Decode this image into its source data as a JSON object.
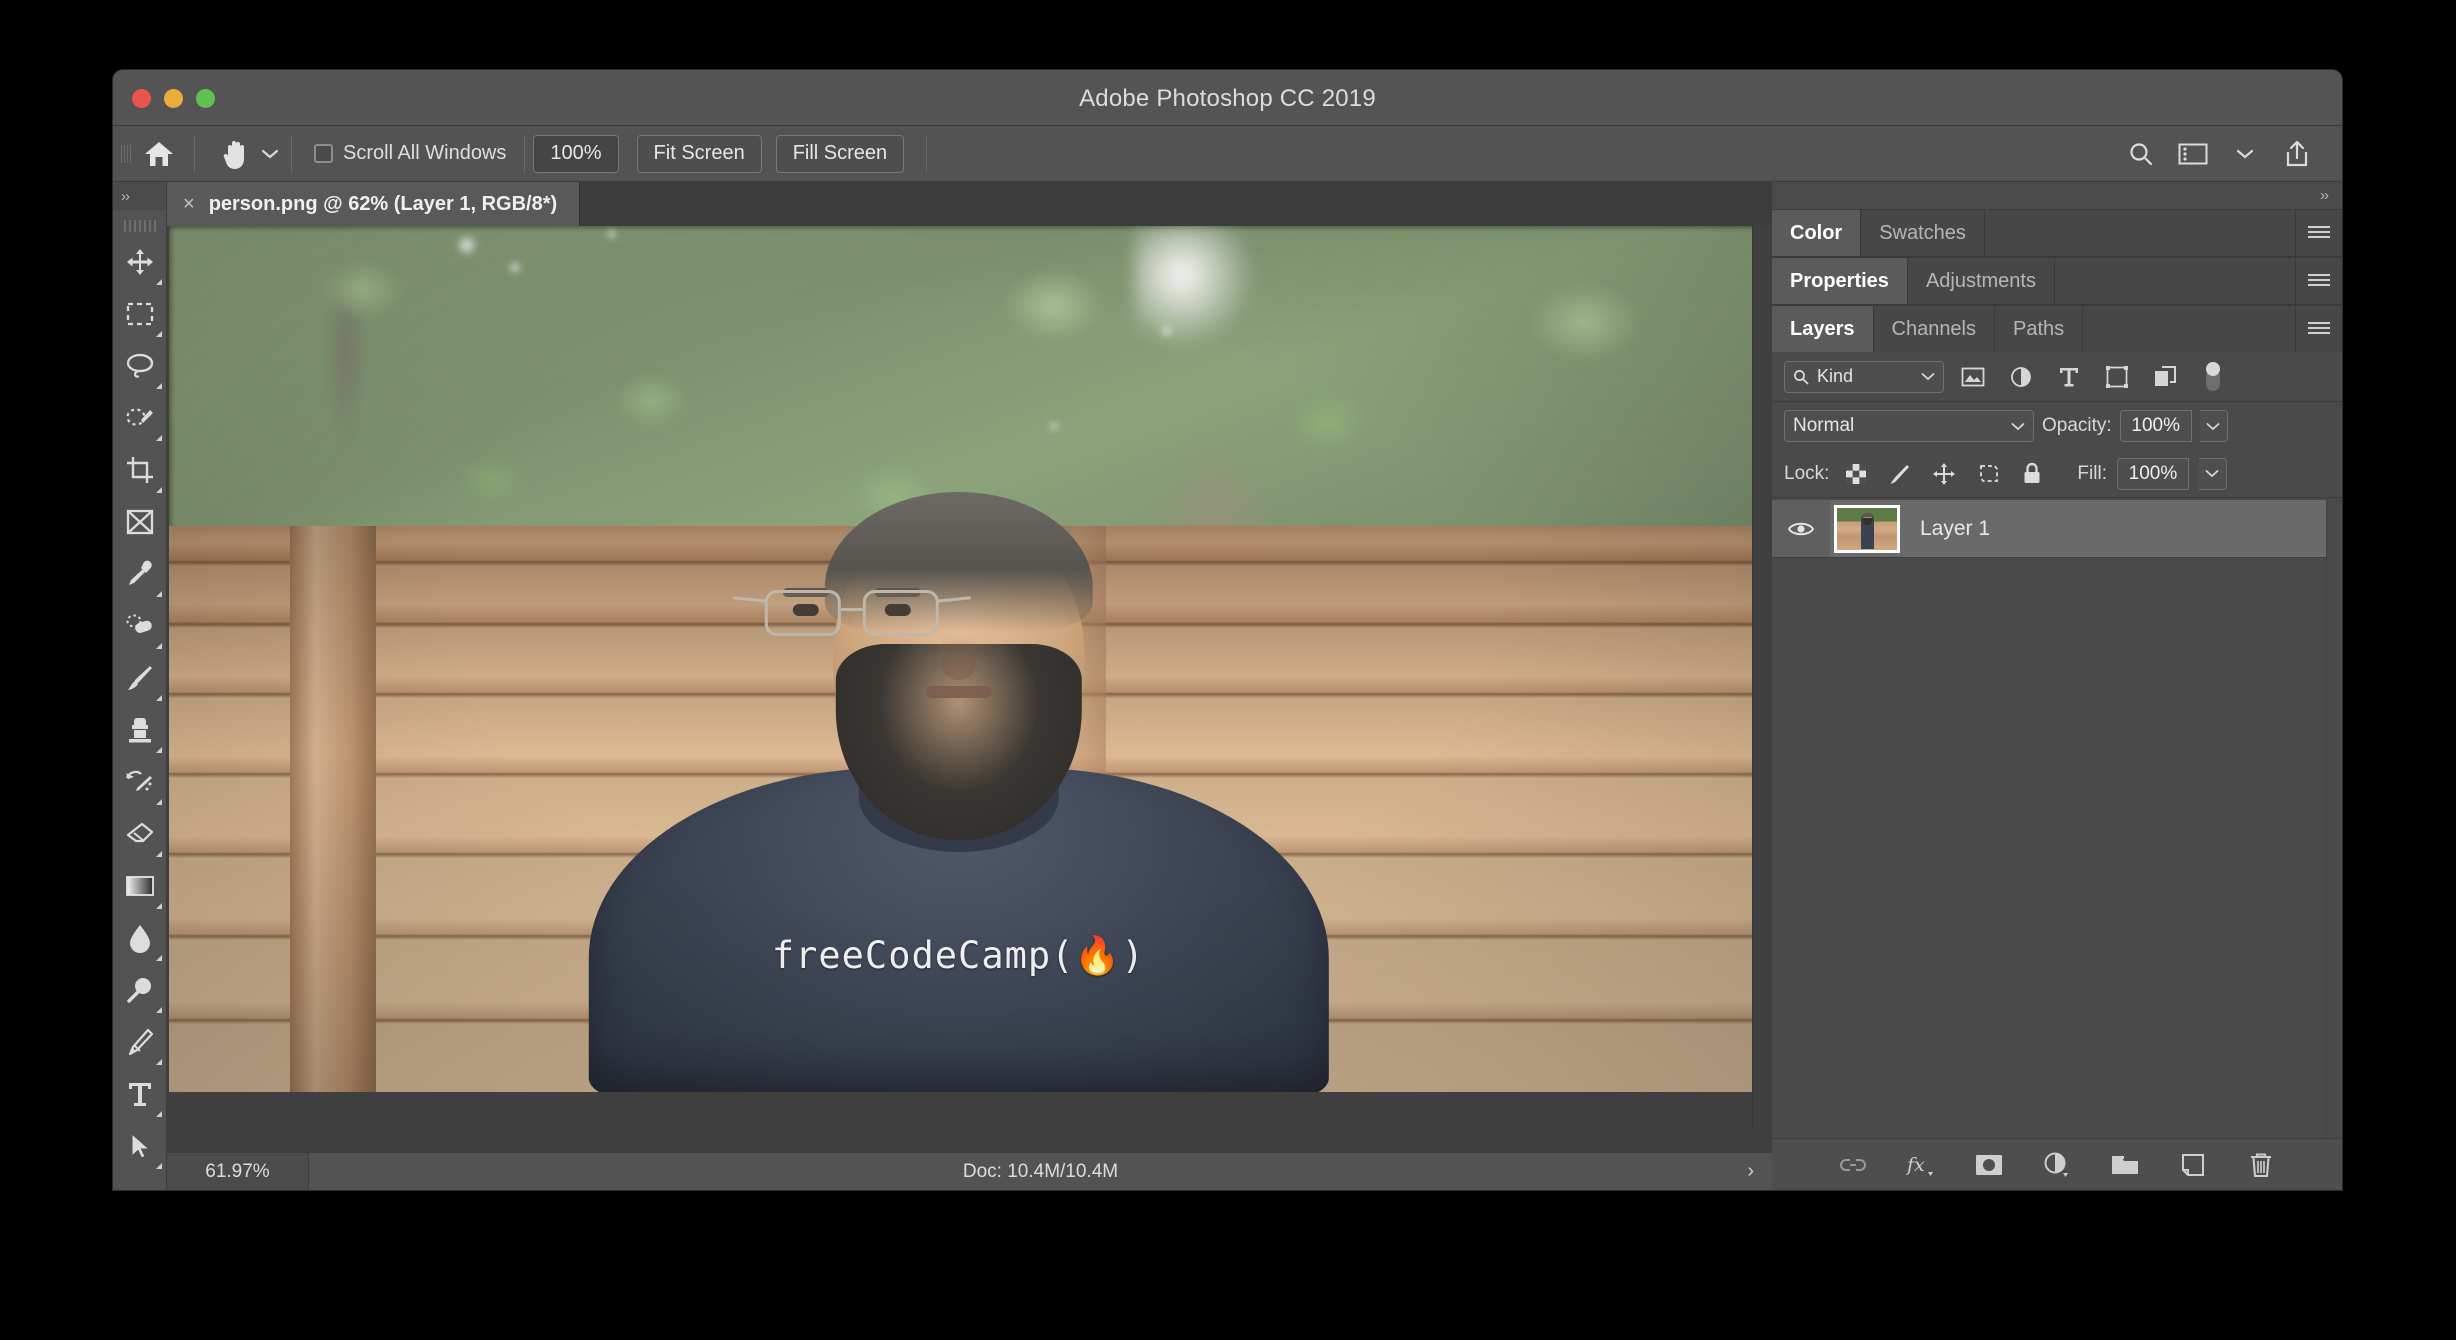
{
  "window": {
    "title": "Adobe Photoshop CC 2019",
    "traffic_lights": [
      "close",
      "minimize",
      "zoom"
    ]
  },
  "options_bar": {
    "home_icon": "home-icon",
    "tool_icon": "hand-tool-icon",
    "tool_caret": "chevron-down-icon",
    "scroll_all_windows": {
      "label": "Scroll All Windows",
      "checked": false
    },
    "zoom_percent": "100%",
    "fit_screen": "Fit Screen",
    "fill_screen": "Fill Screen",
    "right_icons": [
      "search-icon",
      "workspace-icon",
      "chevron-down-icon",
      "share-icon"
    ]
  },
  "toolbar": {
    "collapse_label": "››",
    "tools": [
      {
        "name": "move-tool",
        "glyph": "move",
        "selected": false,
        "has_flyout": true
      },
      {
        "name": "rectangular-marquee-tool",
        "glyph": "marquee",
        "selected": false,
        "has_flyout": true
      },
      {
        "name": "lasso-tool",
        "glyph": "lasso",
        "selected": false,
        "has_flyout": true
      },
      {
        "name": "quick-selection-tool",
        "glyph": "quickselect",
        "selected": false,
        "has_flyout": true
      },
      {
        "name": "crop-tool",
        "glyph": "crop",
        "selected": false,
        "has_flyout": true
      },
      {
        "name": "frame-tool",
        "glyph": "frame",
        "selected": false,
        "has_flyout": false
      },
      {
        "name": "eyedropper-tool",
        "glyph": "eyedropper",
        "selected": false,
        "has_flyout": true
      },
      {
        "name": "healing-brush-tool",
        "glyph": "healing",
        "selected": false,
        "has_flyout": true
      },
      {
        "name": "brush-tool",
        "glyph": "brush",
        "selected": false,
        "has_flyout": true
      },
      {
        "name": "clone-stamp-tool",
        "glyph": "stamp",
        "selected": false,
        "has_flyout": true
      },
      {
        "name": "history-brush-tool",
        "glyph": "historybrush",
        "selected": false,
        "has_flyout": true
      },
      {
        "name": "eraser-tool",
        "glyph": "eraser",
        "selected": false,
        "has_flyout": true
      },
      {
        "name": "gradient-tool",
        "glyph": "gradient",
        "selected": false,
        "has_flyout": true
      },
      {
        "name": "blur-tool",
        "glyph": "blur",
        "selected": false,
        "has_flyout": true
      },
      {
        "name": "dodge-tool",
        "glyph": "dodge",
        "selected": false,
        "has_flyout": true
      },
      {
        "name": "pen-tool",
        "glyph": "pen",
        "selected": false,
        "has_flyout": true
      },
      {
        "name": "type-tool",
        "glyph": "type",
        "selected": false,
        "has_flyout": true
      },
      {
        "name": "path-selection-tool",
        "glyph": "pathselect",
        "selected": false,
        "has_flyout": true
      }
    ]
  },
  "document": {
    "tab_close": "×",
    "tab_label": "person.png @ 62% (Layer 1, RGB/8*)",
    "image_alt": "bearded-man-in-freecodecamp-tshirt-in-front-of-wooden-fence",
    "shirt_text": "freeCodeCamp(🔥)"
  },
  "status_bar": {
    "zoom": "61.97%",
    "doc": "Doc: 10.4M/10.4M",
    "expand_arrow": "›"
  },
  "right_rail": {
    "collapse_label": "››",
    "color_group": {
      "tabs": [
        {
          "label": "Color",
          "active": true
        },
        {
          "label": "Swatches",
          "active": false
        }
      ],
      "menu_icon": "panel-menu-icon"
    },
    "properties_group": {
      "tabs": [
        {
          "label": "Properties",
          "active": true
        },
        {
          "label": "Adjustments",
          "active": false
        }
      ],
      "menu_icon": "panel-menu-icon"
    },
    "layers_group": {
      "tabs": [
        {
          "label": "Layers",
          "active": true
        },
        {
          "label": "Channels",
          "active": false
        },
        {
          "label": "Paths",
          "active": false
        }
      ],
      "menu_icon": "panel-menu-icon"
    }
  },
  "layers_panel": {
    "filter": {
      "search_icon": "search-icon",
      "kind_label": "Kind",
      "caret": "chevron-down-icon",
      "filter_icons": [
        "pixel-layer-filter-icon",
        "adjustment-layer-filter-icon",
        "type-layer-filter-icon",
        "shape-layer-filter-icon",
        "smart-object-filter-icon"
      ],
      "toggle": "filter-toggle-switch"
    },
    "blend": {
      "mode": "Normal",
      "mode_caret": "chevron-down-icon",
      "opacity_label": "Opacity:",
      "opacity_value": "100%",
      "opacity_caret": "chevron-down-icon"
    },
    "lock": {
      "label": "Lock:",
      "icons": [
        "lock-transparent-pixels-icon",
        "lock-image-pixels-icon",
        "lock-position-icon",
        "lock-artboard-nesting-icon",
        "lock-all-icon"
      ],
      "fill_label": "Fill:",
      "fill_value": "100%",
      "fill_caret": "chevron-down-icon"
    },
    "layers": [
      {
        "name": "Layer 1",
        "visible": true,
        "selected": true,
        "thumbnail": "person-photo-thumbnail"
      }
    ],
    "footer_icons": [
      "link-layers-icon",
      "layer-style-fx-icon",
      "add-layer-mask-icon",
      "new-fill-adjustment-layer-icon",
      "new-group-icon",
      "new-layer-icon",
      "delete-layer-icon"
    ]
  },
  "colors": {
    "window_chrome": "#545454",
    "panel_bg": "#4a4a4a",
    "panel_tab_active": "#5b5b5b",
    "canvas_bg": "#3f3f3f",
    "selected_layer": "#6a6a6a",
    "text_primary": "#e6e6e6",
    "text_muted": "#b6b6b6",
    "traffic_red": "#e9554d",
    "traffic_yellow": "#e9ad3a",
    "traffic_green": "#5fc250"
  }
}
